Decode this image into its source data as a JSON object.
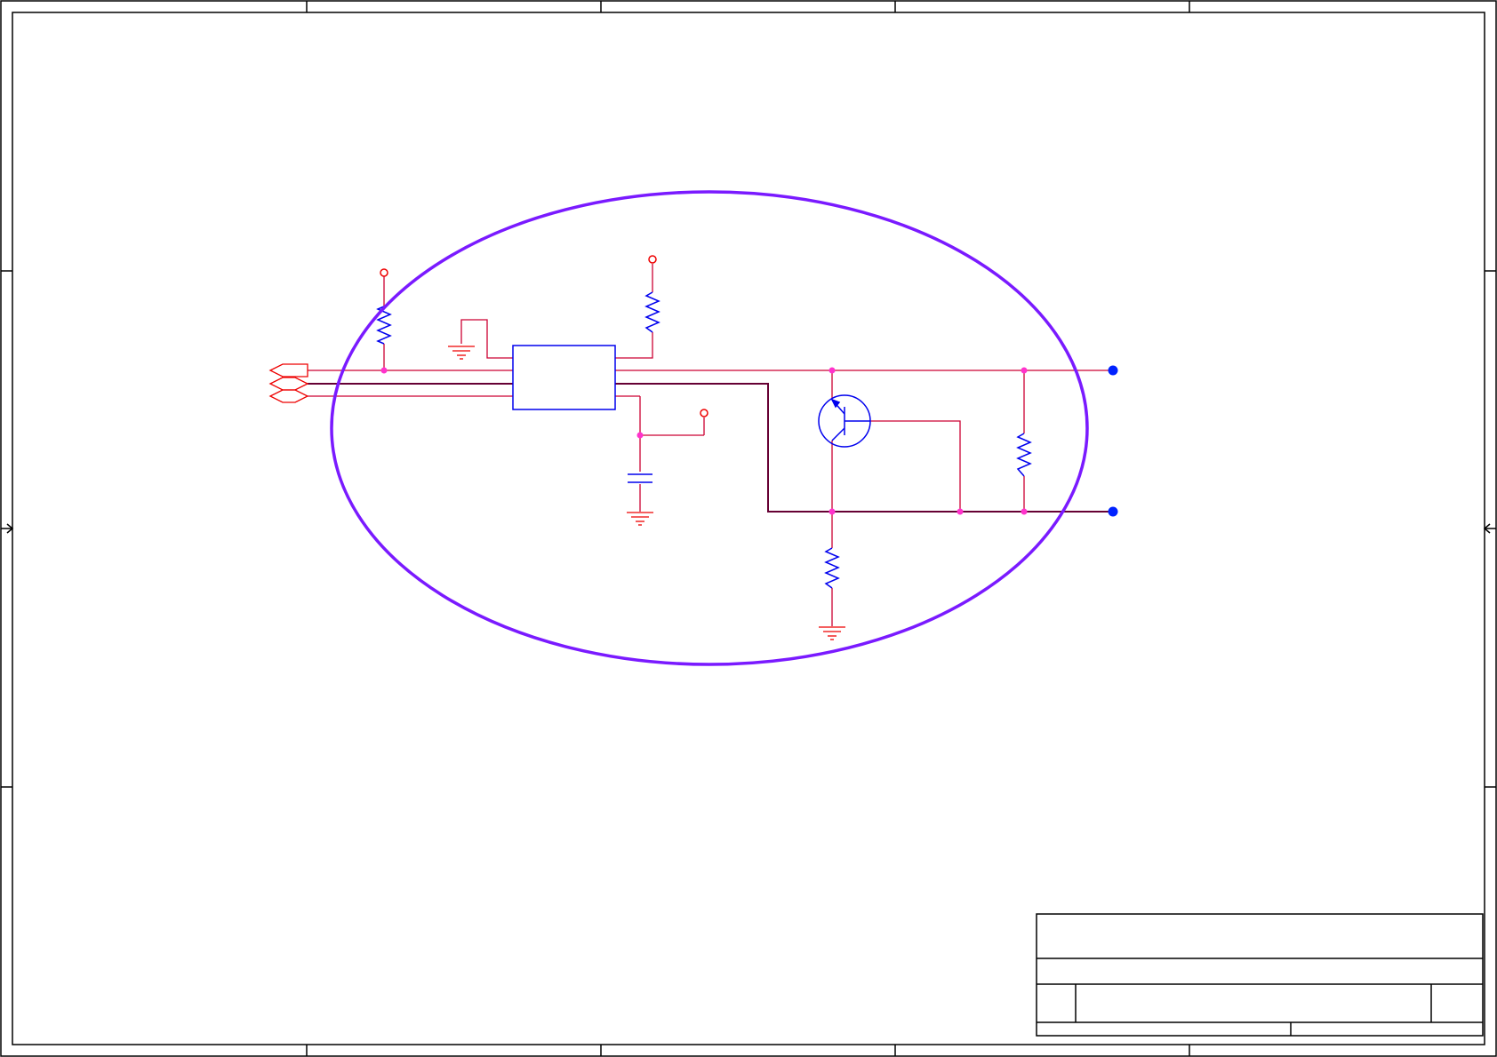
{
  "colors": {
    "frame": "#000000",
    "wire": "#cc0033",
    "bus_wire": "#660033",
    "component": "#0000ee",
    "junction": "#ff33cc",
    "connector": "#ee0000",
    "power": "#ee0000",
    "terminal": "#0022ff",
    "highlight": "#7a1aff",
    "background": "#ffffff"
  },
  "schematic": {
    "components": [
      "pull-up-resistor",
      "bias-resistor",
      "ic",
      "decoupling-capacitor",
      "pnp-transistor",
      "shunt-resistor",
      "emitter-resistor"
    ],
    "power_symbols": [
      "vcc-supply-1",
      "vcc-supply-2",
      "vcc-supply-3"
    ],
    "ground_symbols": [
      "ground-1",
      "ground-2",
      "ground-3"
    ],
    "connectors": [
      "signal-connector-1",
      "signal-connector-2",
      "signal-connector-3"
    ],
    "terminals": [
      "output-terminal-1",
      "output-terminal-2"
    ]
  },
  "title_block": {
    "title": "",
    "size": "",
    "document_number": "",
    "revision": "",
    "date": "",
    "sheet": ""
  }
}
